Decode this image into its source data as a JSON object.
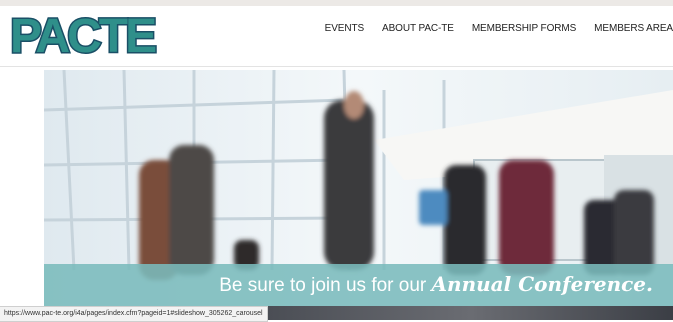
{
  "header": {
    "logo_text": "PACTE",
    "nav": [
      "EVENTS",
      "ABOUT PAC-TE",
      "MEMBERSHIP FORMS",
      "MEMBERS AREA"
    ]
  },
  "hero": {
    "banner_prefix": "Be sure to join us for our ",
    "banner_emphasis": "Annual Conference."
  },
  "status": {
    "url": "https://www.pac-te.org/i4a/pages/index.cfm?pageid=1#slideshow_305262_carousel"
  },
  "colors": {
    "logo_blue": "#1a5f7a",
    "logo_teal": "#2f8f8a",
    "banner": "#7abbbc"
  }
}
